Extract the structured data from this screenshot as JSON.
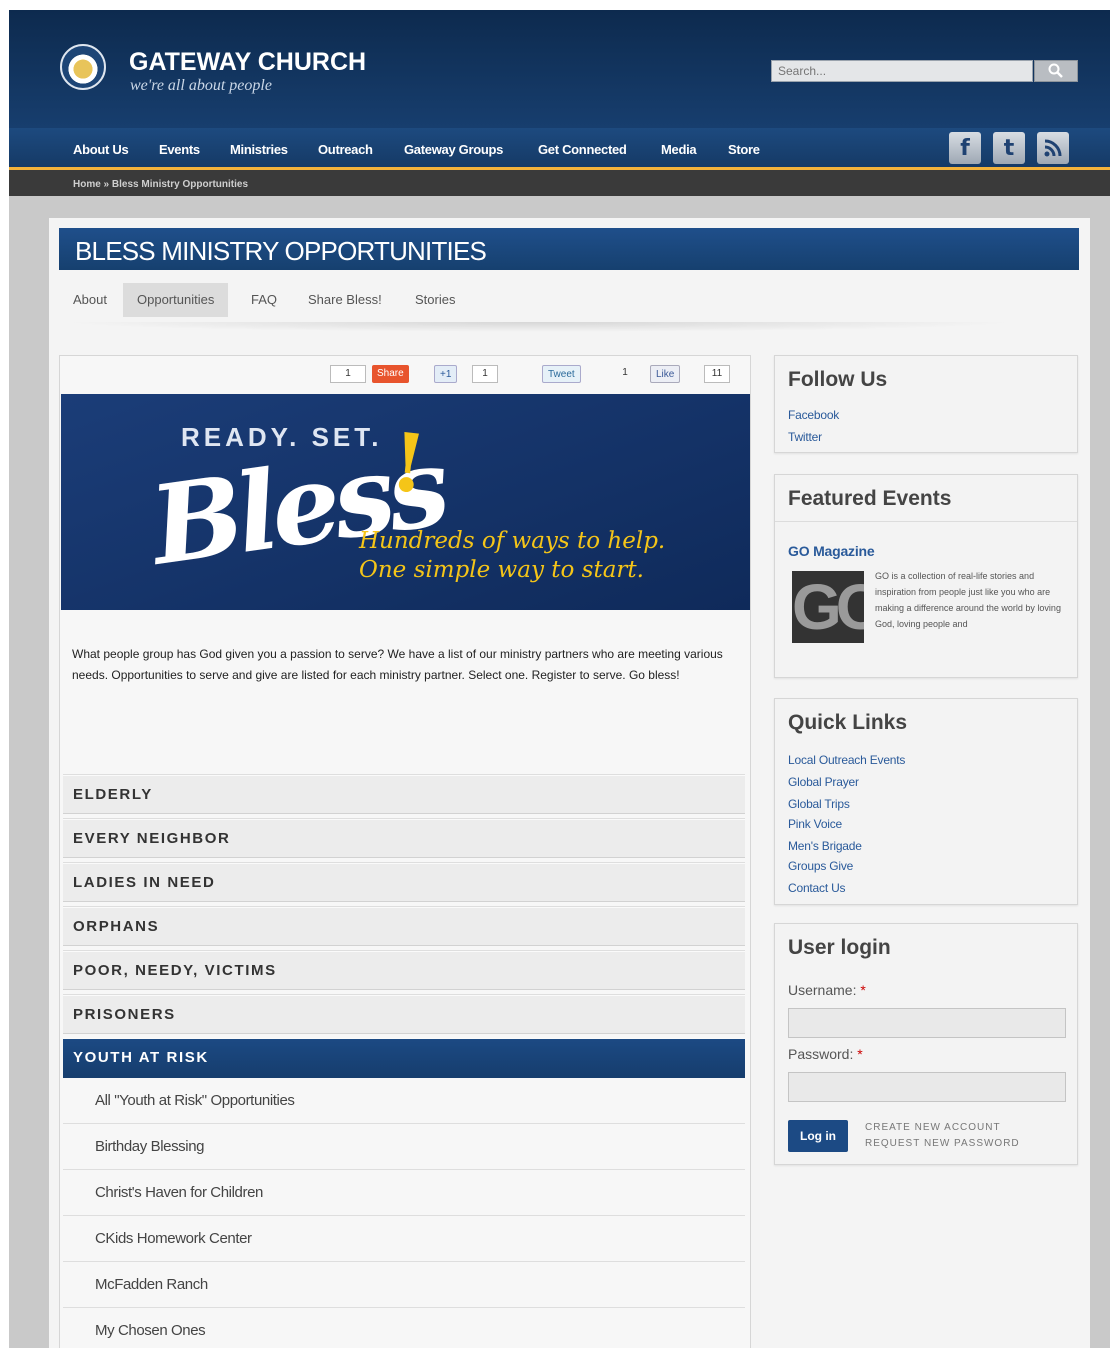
{
  "header": {
    "site_title": "GATEWAY CHURCH",
    "tagline": "we're all about people",
    "search_placeholder": "Search..."
  },
  "nav": {
    "items": [
      {
        "label": "About Us"
      },
      {
        "label": "Events"
      },
      {
        "label": "Ministries"
      },
      {
        "label": "Outreach"
      },
      {
        "label": "Gateway Groups"
      },
      {
        "label": "Get Connected"
      },
      {
        "label": "Media"
      },
      {
        "label": "Store"
      }
    ],
    "social": [
      {
        "icon": "facebook-icon",
        "glyph": "f"
      },
      {
        "icon": "twitter-icon",
        "glyph": "t"
      },
      {
        "icon": "rss-icon",
        "glyph": "☰"
      }
    ]
  },
  "breadcrumb": "Home » Bless Ministry Opportunities",
  "page": {
    "title": "BLESS MINISTRY OPPORTUNITIES",
    "subtabs": [
      {
        "label": "About",
        "active": false
      },
      {
        "label": "Opportunities",
        "active": true
      },
      {
        "label": "FAQ",
        "active": false
      },
      {
        "label": "Share Bless!",
        "active": false
      },
      {
        "label": "Stories",
        "active": false
      }
    ]
  },
  "share": {
    "share_count": "1",
    "share_label": "Share",
    "gplus_label": "+1",
    "gplus_count": "1",
    "tweet_label": "Tweet",
    "tweet_count": "1",
    "like_label": "Like",
    "like_count": "11"
  },
  "banner": {
    "top": "READY. SET.",
    "bless": "Bless",
    "bang": "!",
    "line1": "Hundreds of ways to help.",
    "line2": "One simple way to start."
  },
  "intro": "What people group has God given you a passion to serve? We have a list of our ministry partners who are meeting various needs. Opportunities to serve and give are listed for each ministry partner. Select one. Register to serve. Go bless!",
  "categories": [
    {
      "label": "ELDERLY",
      "active": false
    },
    {
      "label": "EVERY NEIGHBOR",
      "active": false
    },
    {
      "label": "LADIES IN NEED",
      "active": false
    },
    {
      "label": "ORPHANS",
      "active": false
    },
    {
      "label": "POOR, NEEDY, VICTIMS",
      "active": false
    },
    {
      "label": "PRISONERS",
      "active": false
    },
    {
      "label": "YOUTH AT RISK",
      "active": true
    }
  ],
  "youth_items": [
    "All \"Youth at Risk\" Opportunities",
    "Birthday Blessing",
    "Christ's Haven for Children",
    "CKids Homework Center",
    "McFadden Ranch",
    "My Chosen Ones"
  ],
  "sidebar": {
    "follow": {
      "title": "Follow Us",
      "links": [
        "Facebook",
        "Twitter"
      ]
    },
    "featured": {
      "title": "Featured Events",
      "event_title": "GO Magazine",
      "thumb_text": "GO",
      "event_desc": "GO is a collection of real-life stories and inspiration from people just like you who are making a difference around the world by loving God, loving people and"
    },
    "quick": {
      "title": "Quick Links",
      "links": [
        "Local Outreach Events",
        "Global Prayer",
        "Global Trips",
        "Pink Voice",
        "Men's Brigade",
        "Groups Give",
        "Contact Us"
      ]
    },
    "login": {
      "title": "User login",
      "username_label": "Username:",
      "password_label": "Password:",
      "required_mark": "*",
      "button": "Log in",
      "create_link": "CREATE NEW ACCOUNT",
      "request_link": "REQUEST NEW PASSWORD"
    }
  }
}
